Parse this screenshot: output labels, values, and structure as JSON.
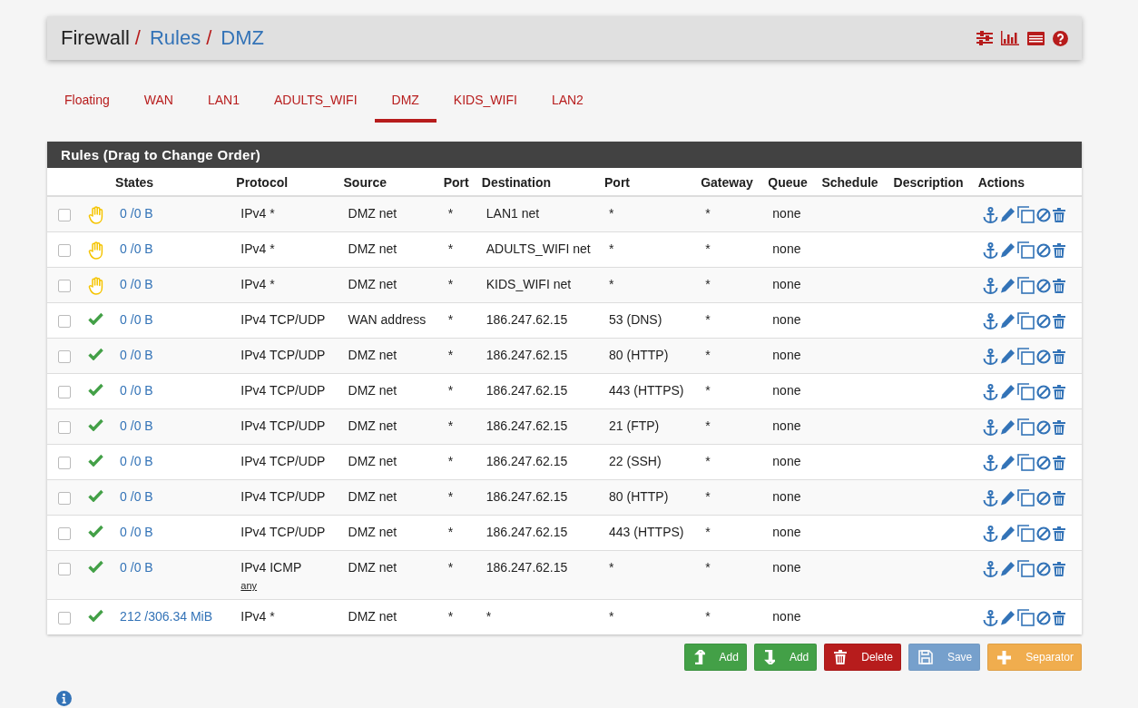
{
  "breadcrumb": [
    {
      "kind": "text",
      "text": "Firewall"
    },
    {
      "kind": "separator",
      "text": "/"
    },
    {
      "kind": "link",
      "text": "Rules"
    },
    {
      "kind": "separator",
      "text": "/"
    },
    {
      "kind": "link",
      "text": "DMZ"
    }
  ],
  "tabs": [
    {
      "label": "Floating",
      "selected": false
    },
    {
      "label": "WAN",
      "selected": false
    },
    {
      "label": "LAN1",
      "selected": false
    },
    {
      "label": "ADULTS_WIFI",
      "selected": false
    },
    {
      "label": "DMZ",
      "selected": true
    },
    {
      "label": "KIDS_WIFI",
      "selected": false
    },
    {
      "label": "LAN2",
      "selected": false
    }
  ],
  "panel": {
    "title": "Rules (Drag to Change Order)"
  },
  "table": {
    "columns": [
      "",
      "",
      "States",
      "Protocol",
      "Source",
      "Port",
      "Destination",
      "Port",
      "Gateway",
      "Queue",
      "Schedule",
      "Description",
      "Actions"
    ],
    "rows": [
      {
        "checked": false,
        "kind": "block",
        "states": "0 /0 B",
        "protocol": "IPv4 *",
        "source": "DMZ net",
        "source_port": "*",
        "destination": "LAN1 net",
        "dest_port": "*",
        "gateway": "*",
        "queue": "none"
      },
      {
        "checked": false,
        "kind": "block",
        "states": "0 /0 B",
        "protocol": "IPv4 *",
        "source": "DMZ net",
        "source_port": "*",
        "destination": "ADULTS_WIFI net",
        "dest_port": "*",
        "gateway": "*",
        "queue": "none"
      },
      {
        "checked": false,
        "kind": "block",
        "states": "0 /0 B",
        "protocol": "IPv4 *",
        "source": "DMZ net",
        "source_port": "*",
        "destination": "KIDS_WIFI net",
        "dest_port": "*",
        "gateway": "*",
        "queue": "none"
      },
      {
        "checked": false,
        "kind": "pass",
        "states": "0 /0 B",
        "protocol": "IPv4 TCP/UDP",
        "source": "WAN address",
        "source_port": "*",
        "destination": "186.247.62.15",
        "dest_port": "53 (DNS)",
        "gateway": "*",
        "queue": "none"
      },
      {
        "checked": false,
        "kind": "pass",
        "states": "0 /0 B",
        "protocol": "IPv4 TCP/UDP",
        "source": "DMZ net",
        "source_port": "*",
        "destination": "186.247.62.15",
        "dest_port": "80 (HTTP)",
        "gateway": "*",
        "queue": "none"
      },
      {
        "checked": false,
        "kind": "pass",
        "states": "0 /0 B",
        "protocol": "IPv4 TCP/UDP",
        "source": "DMZ net",
        "source_port": "*",
        "destination": "186.247.62.15",
        "dest_port": "443 (HTTPS)",
        "gateway": "*",
        "queue": "none"
      },
      {
        "checked": false,
        "kind": "pass",
        "states": "0 /0 B",
        "protocol": "IPv4 TCP/UDP",
        "source": "DMZ net",
        "source_port": "*",
        "destination": "186.247.62.15",
        "dest_port": "21 (FTP)",
        "gateway": "*",
        "queue": "none"
      },
      {
        "checked": false,
        "kind": "pass",
        "states": "0 /0 B",
        "protocol": "IPv4 TCP/UDP",
        "source": "DMZ net",
        "source_port": "*",
        "destination": "186.247.62.15",
        "dest_port": "22 (SSH)",
        "gateway": "*",
        "queue": "none"
      },
      {
        "checked": false,
        "kind": "pass",
        "states": "0 /0 B",
        "protocol": "IPv4 TCP/UDP",
        "source": "DMZ net",
        "source_port": "*",
        "destination": "186.247.62.15",
        "dest_port": "80 (HTTP)",
        "gateway": "*",
        "queue": "none"
      },
      {
        "checked": false,
        "kind": "pass",
        "states": "0 /0 B",
        "protocol": "IPv4 TCP/UDP",
        "source": "DMZ net",
        "source_port": "*",
        "destination": "186.247.62.15",
        "dest_port": "443 (HTTPS)",
        "gateway": "*",
        "queue": "none"
      },
      {
        "checked": false,
        "kind": "pass",
        "states": "0 /0 B",
        "protocol": "IPv4 ICMP",
        "protocol_detail": "any",
        "source": "DMZ net",
        "source_port": "*",
        "destination": "186.247.62.15",
        "dest_port": "*",
        "gateway": "*",
        "queue": "none"
      },
      {
        "checked": false,
        "kind": "pass",
        "states": "212 /306.34 MiB",
        "protocol": "IPv4 *",
        "source": "DMZ net",
        "source_port": "*",
        "destination": "*",
        "dest_port": "*",
        "gateway": "*",
        "queue": "none"
      }
    ]
  },
  "buttons": [
    {
      "kind": "add-top",
      "label": "Add",
      "disabled": false
    },
    {
      "kind": "add-bottom",
      "label": "Add",
      "disabled": false
    },
    {
      "kind": "delete",
      "label": "Delete",
      "disabled": false
    },
    {
      "kind": "save",
      "label": "Save",
      "disabled": true
    },
    {
      "kind": "separator",
      "label": "Separator",
      "disabled": false
    }
  ]
}
